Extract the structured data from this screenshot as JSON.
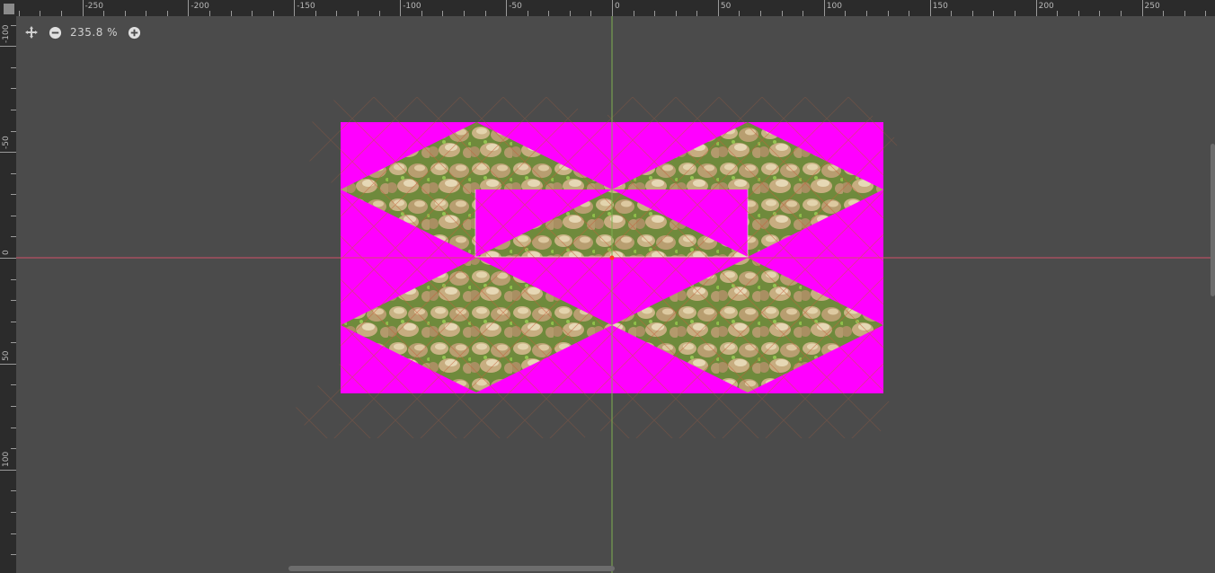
{
  "toolbar": {
    "zoom_level": "235.8 %",
    "fit_icon": "move-arrows-icon",
    "zoom_out_icon": "zoom-out-icon",
    "zoom_in_icon": "zoom-in-icon"
  },
  "rulers": {
    "horizontal_labels": [
      "-250",
      "-200",
      "-150",
      "-100",
      "-50",
      "0",
      "50",
      "100",
      "150",
      "200",
      "250"
    ],
    "vertical_labels": [
      "-100",
      "-50",
      "0",
      "50",
      "100"
    ]
  },
  "colors": {
    "background": "#4b4b4b",
    "magenta": "#ff00ff",
    "x_axis": "#d0506a",
    "y_axis": "#7fb050",
    "grid_lines": "#c0603a"
  }
}
